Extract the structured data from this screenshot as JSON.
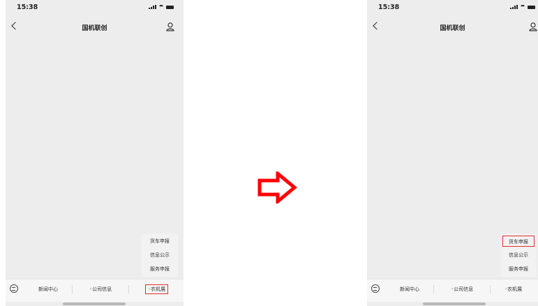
{
  "status_time": "15:38",
  "nav_title": "国机联创",
  "popup_items": [
    "货车申报",
    "信息公示",
    "服务申报"
  ],
  "tabs": [
    "新闻中心",
    "◦公司信息",
    "◦农机展"
  ],
  "colors": {
    "highlight": "#e03030",
    "arrow": "#ff0000"
  },
  "icons": {
    "back": "chevron-left-icon",
    "profile": "user-icon",
    "keyboard": "keyboard-icon",
    "transition": "right-arrow-icon"
  }
}
